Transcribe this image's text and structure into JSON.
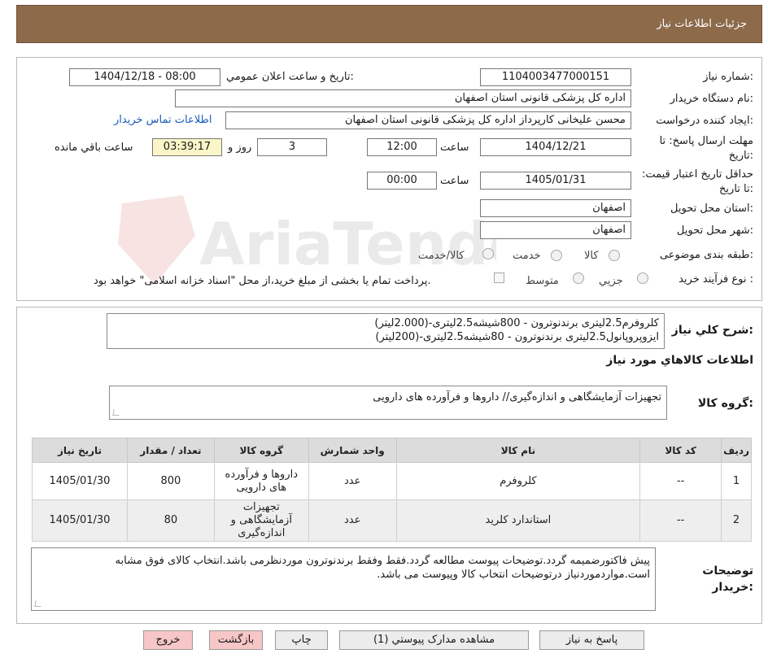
{
  "header": {
    "title": "جزئیات اطلاعات نیاز"
  },
  "need_number": {
    "label": "شماره نیاز:",
    "value": "1104003477000151"
  },
  "announce": {
    "label": "تاریخ و ساعت اعلان عمومي:",
    "value": "1404/12/18 - 08:00"
  },
  "buyer_org": {
    "label": "نام دستگاه خریدار:",
    "value": "اداره کل پزشکی قانونی استان اصفهان"
  },
  "requester": {
    "label": "ایجاد کننده درخواست:",
    "value": "محسن علیخانی کارپرداز اداره کل پزشکی قانونی استان اصفهان",
    "contact_link": "اطلاعات تماس خریدار"
  },
  "deadline": {
    "label": "مهلت ارسال پاسخ: تا تاریخ:",
    "date": "1404/12/21",
    "time_label": "ساعت",
    "time": "12:00",
    "days": "3",
    "days_label": "روز و",
    "remaining": "03:39:17",
    "remaining_label": "ساعت باقي مانده"
  },
  "validity": {
    "label": "حداقل تاریخ اعتبار قیمت: تا تاریخ:",
    "date": "1405/01/31",
    "time_label": "ساعت",
    "time": "00:00"
  },
  "delivery_province": {
    "label": "استان محل تحویل:",
    "value": "اصفهان"
  },
  "delivery_city": {
    "label": "شهر محل تحویل:",
    "value": "اصفهان"
  },
  "category": {
    "label": "طبقه بندی موضوعی:",
    "options": [
      "کالا",
      "خدمت",
      "کالا/خدمت"
    ]
  },
  "process": {
    "label": "نوع فرآیند خرید :",
    "options": [
      "جزیي",
      "متوسط"
    ],
    "payment_note": "پرداخت تمام یا بخشی از مبلغ خرید،از محل \"اسناد خزانه اسلامی\" خواهد بود."
  },
  "description": {
    "label": "شرح کلي نیاز:",
    "lines": [
      "کلروفرم2.5لیتری برندنوترون - 800شیشه2.5لیتری-(2.000لیتر)",
      "ایزوپروپانول2.5لیتری برندنوترون - 80شیشه2.5لیتری-(200لیتر)"
    ]
  },
  "items_section": {
    "title": "اطلاعات کالاهاي مورد نیاز"
  },
  "goods_group": {
    "label": "گروه کالا:",
    "value": "تجهیزات آزمایشگاهی و اندازه‌گیری// داروها و فرآورده های دارویی"
  },
  "table": {
    "headers": [
      "ردیف",
      "کد کالا",
      "نام کالا",
      "واحد شمارش",
      "گروه کالا",
      "تعداد / مقدار",
      "تاریخ نیاز"
    ],
    "rows": [
      {
        "index": "1",
        "code": "--",
        "name": "کلروفرم",
        "unit": "عدد",
        "group": [
          "داروها و فرآورده",
          "های دارویی"
        ],
        "qty": "800",
        "date": "1405/01/30"
      },
      {
        "index": "2",
        "code": "--",
        "name": "استاندارد کلرید",
        "unit": "عدد",
        "group": [
          "تجهیزات",
          "آزمایشگاهی و",
          "اندازه‌گیری"
        ],
        "qty": "80",
        "date": "1405/01/30"
      }
    ]
  },
  "buyer_notes": {
    "label": "توضیحات خریدار:",
    "text": "پیش فاکتورضمیمه گردد.توضیحات پیوست مطالعه گردد.فقط وفقط برندنوترون موردنظرمی باشد.انتخاب کالای فوق مشابه است.مواردموردنیاز درتوضیحات انتخاب کالا وپیوست می باشد."
  },
  "buttons": {
    "reply": "پاسخ به نیاز",
    "attachments": "مشاهده مدارک پیوستي (1)",
    "print": "چاپ",
    "back": "بازگشت",
    "exit": "خروج"
  },
  "colors": {
    "header_bg": "#8c6a4a",
    "link": "#1a5bb8",
    "remaining_bg": "#fbf6c8",
    "danger_btn": "#f7c6c6"
  },
  "watermark": {
    "text": "AriaTender.neT"
  }
}
